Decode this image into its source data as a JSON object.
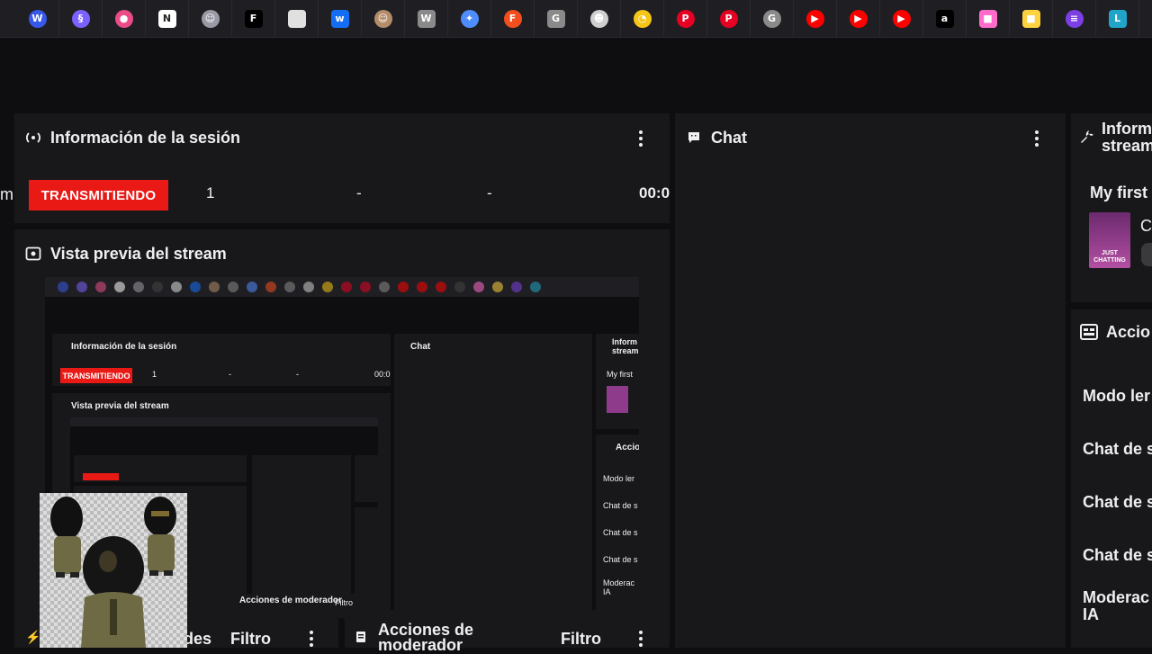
{
  "bookmarks": [
    {
      "name": "wordpress-icon",
      "glyph": "W",
      "color": "#3858e9"
    },
    {
      "name": "app-logo-icon",
      "glyph": "§",
      "color": "#7b61ff"
    },
    {
      "name": "dribbble-icon",
      "glyph": "●",
      "color": "#ea4c89"
    },
    {
      "name": "notion-icon",
      "glyph": "N",
      "color": "#ffffff"
    },
    {
      "name": "avatar-bookmark-icon",
      "glyph": "☺",
      "color": "#9a9aa5"
    },
    {
      "name": "framer-icon",
      "glyph": "F",
      "color": "#000000"
    },
    {
      "name": "blank-page-icon",
      "glyph": "",
      "color": "#e0e0e0"
    },
    {
      "name": "webflow-icon",
      "glyph": "w",
      "color": "#146ef5"
    },
    {
      "name": "profile-bookmark-icon",
      "glyph": "☺",
      "color": "#b58c6a"
    },
    {
      "name": "w-letter-icon",
      "glyph": "W",
      "color": "#8a8a8a"
    },
    {
      "name": "gemini-icon",
      "glyph": "✦",
      "color": "#4f8cff"
    },
    {
      "name": "figma-icon",
      "glyph": "F",
      "color": "#f24e1e"
    },
    {
      "name": "g-letter-icon",
      "glyph": "G",
      "color": "#8a8a8a"
    },
    {
      "name": "character-bookmark-icon",
      "glyph": "☻",
      "color": "#cfcfcf"
    },
    {
      "name": "clock-bookmark-icon",
      "glyph": "◔",
      "color": "#f5c518"
    },
    {
      "name": "pinterest-icon",
      "glyph": "P",
      "color": "#e60023"
    },
    {
      "name": "pinterest-icon-2",
      "glyph": "P",
      "color": "#e60023"
    },
    {
      "name": "g-letter-icon-2",
      "glyph": "G",
      "color": "#8a8a8a"
    },
    {
      "name": "youtube-icon",
      "glyph": "▶",
      "color": "#ff0000"
    },
    {
      "name": "youtube-icon-2",
      "glyph": "▶",
      "color": "#ff0000"
    },
    {
      "name": "youtube-icon-3",
      "glyph": "▶",
      "color": "#ff0000"
    },
    {
      "name": "a-letter-icon",
      "glyph": "a",
      "color": "#000000"
    },
    {
      "name": "colorful-square-icon",
      "glyph": "■",
      "color": "#ff6bcb"
    },
    {
      "name": "colorful-square-icon-2",
      "glyph": "■",
      "color": "#ffd23f"
    },
    {
      "name": "stripes-icon",
      "glyph": "≡",
      "color": "#7b3fe4"
    },
    {
      "name": "l-letter-icon",
      "glyph": "L",
      "color": "#20a4c7"
    }
  ],
  "session": {
    "title": "Información de la sesión",
    "status": "TRANSMITIENDO",
    "viewers": "1",
    "stat2": "-",
    "stat3": "-",
    "time": "00:0",
    "left_fragment": "m"
  },
  "preview": {
    "title": "Vista previa del stream"
  },
  "chat": {
    "title": "Chat"
  },
  "stream_info": {
    "title_line1": "Inform",
    "title_line2": "stream",
    "stream_title": "My first",
    "category_fragment": "C",
    "category_art_line1": "JUST",
    "category_art_line2": "CHATTING"
  },
  "actions": {
    "title": "Accio",
    "items": [
      "Modo ler",
      "Chat de s",
      "Chat de s",
      "Chat de s",
      "Moderac\nIA"
    ]
  },
  "bottom_panels": {
    "left_partial": "des",
    "left_filter": "Filtro",
    "mod_title": "Acciones de moderador",
    "mod_filter": "Filtro"
  },
  "nested": {
    "session_title": "Información de la sesión",
    "status": "TRANSMITIENDO",
    "viewers": "1",
    "stat2": "-",
    "stat3": "-",
    "time": "00:0",
    "preview_title": "Vista previa del stream",
    "chat_title": "Chat",
    "info_title": "Inform stream",
    "stream_title": "My first",
    "actions_title": "Accio",
    "action_items": [
      "Modo ler",
      "Chat de s",
      "Chat de s",
      "Chat de s",
      "Moderac IA"
    ],
    "mod_title": "Acciones de moderador",
    "filter": "Filtro"
  }
}
